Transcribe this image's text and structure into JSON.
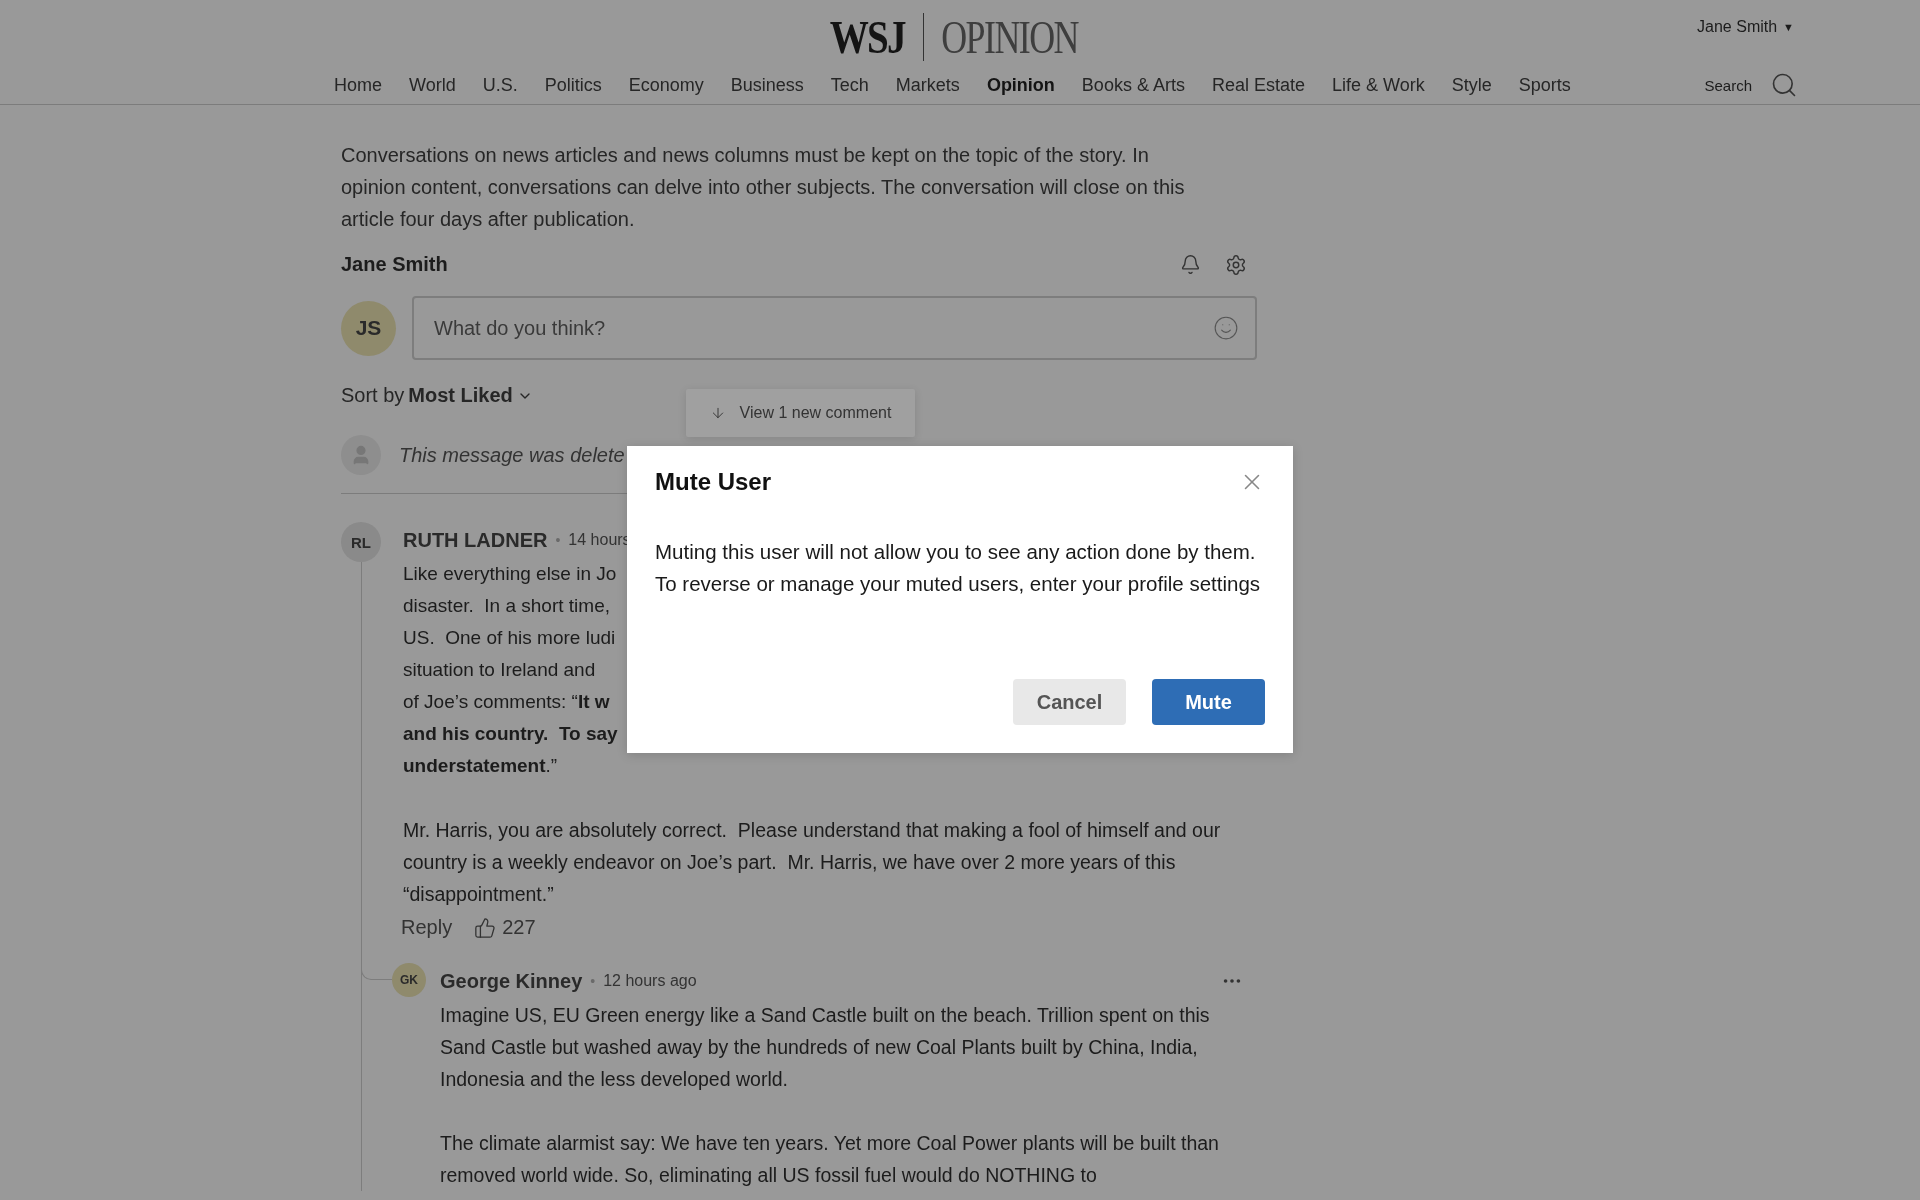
{
  "header": {
    "logo": {
      "brand": "WSJ",
      "section": "OPINION"
    },
    "user": "Jane Smith",
    "user_caret": "▼",
    "nav": [
      {
        "label": "Home",
        "selected": false
      },
      {
        "label": "World",
        "selected": false
      },
      {
        "label": "U.S.",
        "selected": false
      },
      {
        "label": "Politics",
        "selected": false
      },
      {
        "label": "Economy",
        "selected": false
      },
      {
        "label": "Business",
        "selected": false
      },
      {
        "label": "Tech",
        "selected": false
      },
      {
        "label": "Markets",
        "selected": false
      },
      {
        "label": "Opinion",
        "selected": true
      },
      {
        "label": "Books & Arts",
        "selected": false
      },
      {
        "label": "Real Estate",
        "selected": false
      },
      {
        "label": "Life & Work",
        "selected": false
      },
      {
        "label": "Style",
        "selected": false
      },
      {
        "label": "Sports",
        "selected": false
      }
    ],
    "search": "Search"
  },
  "notice": "Conversations on news articles and news columns must be kept on the topic of the story. In opinion content, conversations can delve into other subjects. The conversation will close on this article four days after publication.",
  "composer": {
    "user_name": "Jane Smith",
    "initials": "JS",
    "placeholder": "What do you think?"
  },
  "sort": {
    "prefix": "Sort by",
    "value": "Most Liked"
  },
  "new_comments": "View 1 new comment",
  "deleted_message": "This message was delete",
  "comment": {
    "initials": "RL",
    "name": "RUTH LADNER",
    "separator": "•",
    "time": "14 hours",
    "cut_lines": [
      "Like everything else in Jo",
      "disaster.  In a short time,",
      "US.  One of his more ludi",
      "situation to Ireland and",
      "of Joe’s comments: “**It w**",
      "**and his country.  To say**",
      "**understatement**.”"
    ],
    "body": [
      "Mr. Harris, you are absolutely correct.  Please understand that making a fool of himself and our country is a weekly endeavor on Joe’s part.  Mr. Harris, we have over 2 more years of this “disappointment.”"
    ],
    "reply": "Reply",
    "likes": "227",
    "replies": [
      {
        "initials": "GK",
        "name": "George Kinney",
        "separator": "•",
        "time": "12 hours ago",
        "body": [
          "Imagine US, EU Green energy like a Sand Castle built on the beach. Trillion spent on this Sand Castle but washed away by the hundreds of new Coal Plants built by China, India, Indonesia and the less developed world.",
          "The climate alarmist say: We have ten years. Yet more Coal Power plants will be built than removed world wide. So, eliminating all US fossil fuel would do NOTHING to"
        ]
      }
    ]
  },
  "modal": {
    "title": "Mute User",
    "body": "Muting this user will not allow you to see any action done by them. To reverse or manage your muted users, enter your profile settings",
    "buttons": [
      {
        "label": "Cancel",
        "kind": "secondary"
      },
      {
        "label": "Mute",
        "kind": "primary"
      }
    ]
  }
}
